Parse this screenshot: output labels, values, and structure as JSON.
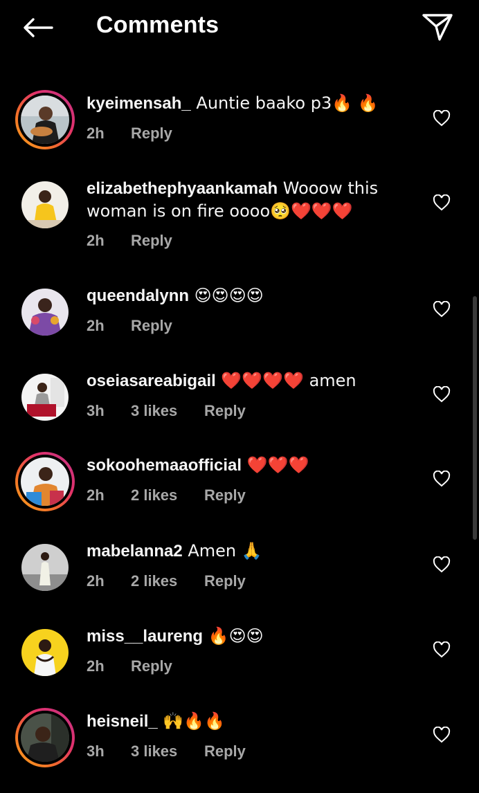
{
  "header": {
    "title": "Comments"
  },
  "comments": [
    {
      "username": "kyeimensah_",
      "text": " Auntie baako p3🔥 🔥",
      "time": "2h",
      "likes": "",
      "reply": "Reply",
      "story_ring": true
    },
    {
      "username": "elizabethephyaankamah",
      "text": " Wooow this woman is on fire oooo🥺❤️❤️❤️",
      "time": "2h",
      "likes": "",
      "reply": "Reply",
      "story_ring": false
    },
    {
      "username": "queendalynn",
      "text": " 😍😍😍😍",
      "time": "2h",
      "likes": "",
      "reply": "Reply",
      "story_ring": false
    },
    {
      "username": "oseiasareabigail",
      "text": " ❤️❤️❤️❤️ amen",
      "time": "3h",
      "likes": "3 likes",
      "reply": "Reply",
      "story_ring": false
    },
    {
      "username": "sokoohemaaofficial",
      "text": " ❤️❤️❤️",
      "time": "2h",
      "likes": "2 likes",
      "reply": "Reply",
      "story_ring": true
    },
    {
      "username": "mabelanna2",
      "text": " Amen 🙏",
      "time": "2h",
      "likes": "2 likes",
      "reply": "Reply",
      "story_ring": false
    },
    {
      "username": "miss__laureng",
      "text": " 🔥😍😍",
      "time": "2h",
      "likes": "",
      "reply": "Reply",
      "story_ring": false
    },
    {
      "username": "heisneil_",
      "text": " 🙌🔥🔥",
      "time": "3h",
      "likes": "3 likes",
      "reply": "Reply",
      "story_ring": true
    }
  ],
  "icons": {
    "back": "arrow-left-icon",
    "share": "paper-plane-icon",
    "like": "heart-outline-icon"
  },
  "colors": {
    "background": "#000000",
    "text": "#ffffff",
    "meta": "#a8a8a8",
    "ring_start": "#f9a61b",
    "ring_end": "#c13584"
  }
}
